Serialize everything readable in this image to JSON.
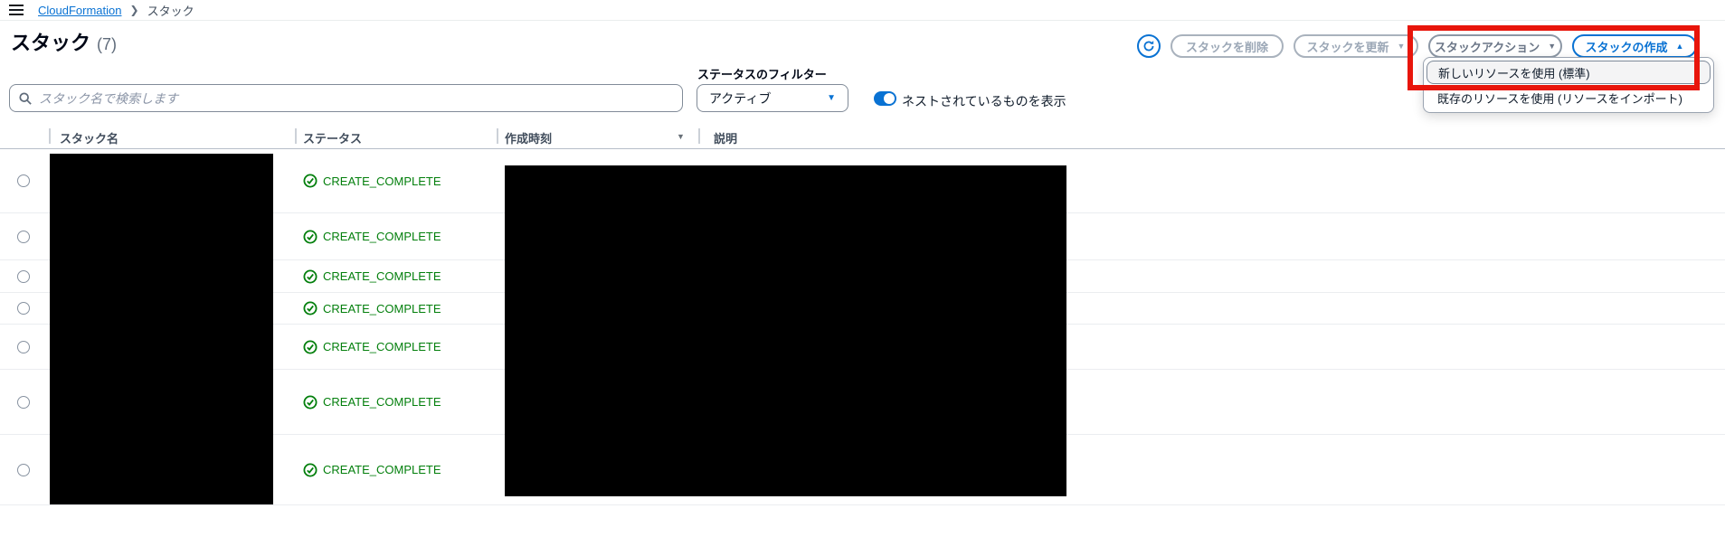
{
  "colors": {
    "accent_blue": "#0972d3",
    "success_green": "#037f0c",
    "annotation_red": "#e8150b",
    "disabled_gray": "#9ba7b6"
  },
  "icons": {
    "menu_icon": "hamburger",
    "search_icon": "magnifier",
    "refresh_icon": "circular-arrow",
    "success_icon": "check-circle",
    "caret_down": "▼",
    "caret_up": "▲",
    "sort_desc": "▼"
  },
  "breadcrumb": {
    "items": [
      {
        "label": "CloudFormation",
        "link": true
      },
      {
        "label": "スタック",
        "link": false
      }
    ]
  },
  "header": {
    "title": "スタック",
    "count": "(7)"
  },
  "toolbar": {
    "delete_label": "スタックを削除",
    "update_label": "スタックを更新",
    "actions_label": "スタックアクション",
    "create_label": "スタックの作成"
  },
  "create_menu": {
    "items": [
      {
        "label": "新しいリソースを使用 (標準)",
        "highlighted": true
      },
      {
        "label": "既存のリソースを使用 (リソースをインポート)",
        "highlighted": false
      }
    ]
  },
  "filters": {
    "search_placeholder": "スタック名で検索します",
    "search_value": "",
    "status_filter_label": "ステータスのフィルター",
    "status_filter_value": "アクティブ",
    "toggle_label": "ネストされているものを表示",
    "toggle_on": true
  },
  "table": {
    "columns": [
      {
        "label": "スタック名"
      },
      {
        "label": "ステータス"
      },
      {
        "label": "作成時刻",
        "sorted": "desc"
      },
      {
        "label": "説明"
      }
    ],
    "rows": [
      {
        "status": "CREATE_COMPLETE"
      },
      {
        "status": "CREATE_COMPLETE"
      },
      {
        "status": "CREATE_COMPLETE"
      },
      {
        "status": "CREATE_COMPLETE"
      },
      {
        "status": "CREATE_COMPLETE"
      },
      {
        "status": "CREATE_COMPLETE"
      },
      {
        "status": "CREATE_COMPLETE"
      }
    ]
  }
}
